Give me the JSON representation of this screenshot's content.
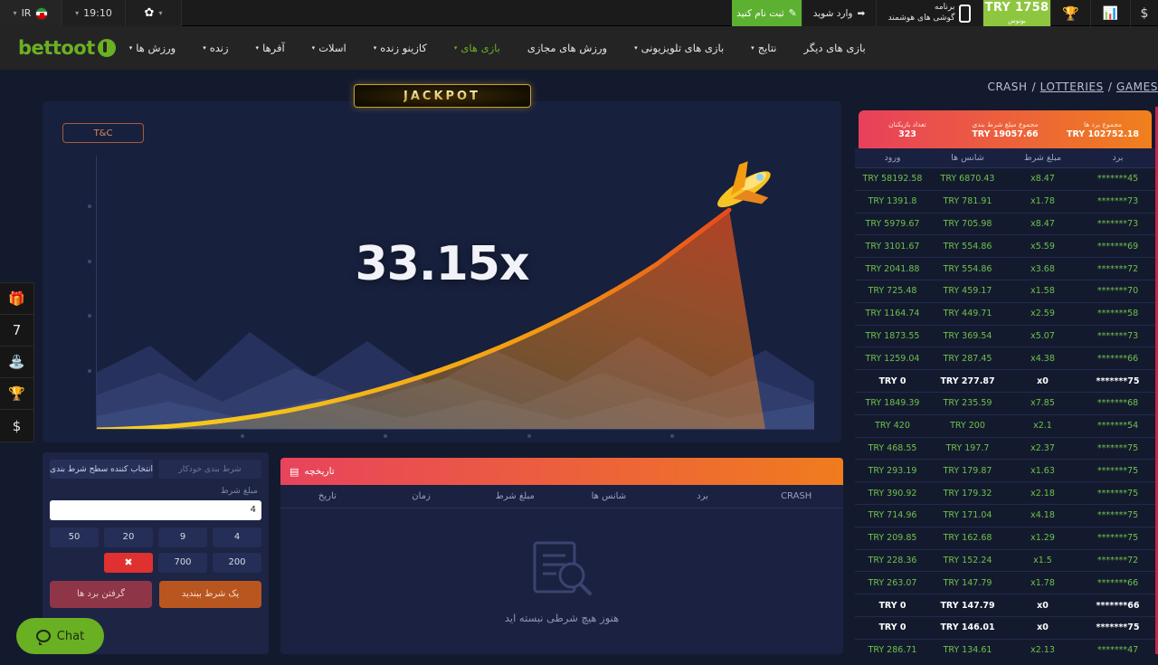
{
  "topbar": {
    "language": "IR",
    "language_icon": "iran-flag-icon",
    "time": "19:10",
    "gear_icon": "gear-icon",
    "signup_label": "ثبت نام کنید",
    "signup_icon": "pencil-icon",
    "login_label": "وارد شوید",
    "login_icon": "login-arrow-icon",
    "apps_line1": "برنامه",
    "apps_line2": "گوشی های هوشمند",
    "apps_icon": "smartphone-icon",
    "bonus_amount": "TRY 1758",
    "bonus_label": "بونوس",
    "trophy_icon": "trophy-icon",
    "stats_icon": "bar-chart-icon",
    "currency_icon": "dollar-icon"
  },
  "nav": {
    "logo_text": "bettoot",
    "items": [
      {
        "label": "ورزش ها",
        "caret": "▾",
        "active": false
      },
      {
        "label": "زنده",
        "caret": "▾",
        "active": false
      },
      {
        "label": "آفرها",
        "caret": "▾",
        "active": false
      },
      {
        "label": "اسلات",
        "caret": "▾",
        "active": false
      },
      {
        "label": "کازینو زنده",
        "caret": "▾",
        "active": false
      },
      {
        "label": "بازی های",
        "caret": "▾",
        "active": true
      },
      {
        "label": "ورزش های مجازی",
        "caret": "",
        "active": false
      },
      {
        "label": "بازی های تلویزیونی",
        "caret": "▾",
        "active": false
      },
      {
        "label": "نتایج",
        "caret": "▾",
        "active": false
      },
      {
        "label": "بازی های دیگر",
        "caret": "",
        "active": false
      }
    ]
  },
  "breadcrumb": {
    "items": [
      "CRASH",
      "LOTTERIES",
      "GAMES"
    ],
    "separator": "/"
  },
  "rail": {
    "items": [
      {
        "name": "gift-icon",
        "glyph": "🎁"
      },
      {
        "name": "seven-icon",
        "glyph": "7"
      },
      {
        "name": "fountain-icon",
        "glyph": "⛲"
      },
      {
        "name": "trophy-icon",
        "glyph": "🏆"
      },
      {
        "name": "dollar-coin-icon",
        "glyph": "$"
      }
    ]
  },
  "game": {
    "jackpot_label": "JACKPOT",
    "tnc_label": "T&C",
    "multiplier": "33.15x"
  },
  "bet_panel": {
    "tab_manual": "انتخاب کننده سطح شرط بندی",
    "tab_auto": "شرط بندی خودکار",
    "amount_label": "مبلغ شرط",
    "amount_value": "4",
    "amount_placeholder": "0",
    "chips": [
      "50",
      "20",
      "9",
      "4"
    ],
    "chips_row2": [
      "",
      "✖",
      "700",
      "200"
    ],
    "clear_icon": "clear-x-icon",
    "take_wins_label": "گرفتن برد ها",
    "place_bet_label": "یک شرط ببندید"
  },
  "history": {
    "title": "تاریخچه",
    "title_icon": "history-icon",
    "columns": [
      "تاریخ",
      "زمان",
      "مبلغ شرط",
      "شانس ها",
      "برد",
      "CRASH"
    ],
    "empty_message": "هنوز هیچ شرطی نبسته اید",
    "empty_icon": "document-search-icon"
  },
  "leaderboard": {
    "stats": [
      {
        "label": "تعداد بازیکنان",
        "value": "323",
        "icon": "user-icon"
      },
      {
        "label": "مجموع مبلغ شرط بندی",
        "value": "TRY 19057.66",
        "icon": "chip-icon"
      },
      {
        "label": "مجموع برد ها",
        "value": "TRY 102752.18",
        "icon": "fire-icon"
      }
    ],
    "columns": [
      "ورود",
      "شانس ها",
      "مبلغ شرط",
      "برد"
    ],
    "rows": [
      {
        "user": "*******45",
        "odds": "x8.47",
        "bet": "TRY 6870.43",
        "win": "TRY 58192.58",
        "zero": false
      },
      {
        "user": "*******73",
        "odds": "x1.78",
        "bet": "TRY 781.91",
        "win": "TRY 1391.8",
        "zero": false
      },
      {
        "user": "*******73",
        "odds": "x8.47",
        "bet": "TRY 705.98",
        "win": "TRY 5979.67",
        "zero": false
      },
      {
        "user": "*******69",
        "odds": "x5.59",
        "bet": "TRY 554.86",
        "win": "TRY 3101.67",
        "zero": false
      },
      {
        "user": "*******72",
        "odds": "x3.68",
        "bet": "TRY 554.86",
        "win": "TRY 2041.88",
        "zero": false
      },
      {
        "user": "*******70",
        "odds": "x1.58",
        "bet": "TRY 459.17",
        "win": "TRY 725.48",
        "zero": false
      },
      {
        "user": "*******58",
        "odds": "x2.59",
        "bet": "TRY 449.71",
        "win": "TRY 1164.74",
        "zero": false
      },
      {
        "user": "*******73",
        "odds": "x5.07",
        "bet": "TRY 369.54",
        "win": "TRY 1873.55",
        "zero": false
      },
      {
        "user": "*******66",
        "odds": "x4.38",
        "bet": "TRY 287.45",
        "win": "TRY 1259.04",
        "zero": false
      },
      {
        "user": "*******75",
        "odds": "x0",
        "bet": "TRY 277.87",
        "win": "TRY 0",
        "zero": true
      },
      {
        "user": "*******68",
        "odds": "x7.85",
        "bet": "TRY 235.59",
        "win": "TRY 1849.39",
        "zero": false
      },
      {
        "user": "*******54",
        "odds": "x2.1",
        "bet": "TRY 200",
        "win": "TRY 420",
        "zero": false
      },
      {
        "user": "*******75",
        "odds": "x2.37",
        "bet": "TRY 197.7",
        "win": "TRY 468.55",
        "zero": false
      },
      {
        "user": "*******75",
        "odds": "x1.63",
        "bet": "TRY 179.87",
        "win": "TRY 293.19",
        "zero": false
      },
      {
        "user": "*******75",
        "odds": "x2.18",
        "bet": "TRY 179.32",
        "win": "TRY 390.92",
        "zero": false
      },
      {
        "user": "*******75",
        "odds": "x4.18",
        "bet": "TRY 171.04",
        "win": "TRY 714.96",
        "zero": false
      },
      {
        "user": "*******75",
        "odds": "x1.29",
        "bet": "TRY 162.68",
        "win": "TRY 209.85",
        "zero": false
      },
      {
        "user": "*******72",
        "odds": "x1.5",
        "bet": "TRY 152.24",
        "win": "TRY 228.36",
        "zero": false
      },
      {
        "user": "*******66",
        "odds": "x1.78",
        "bet": "TRY 147.79",
        "win": "TRY 263.07",
        "zero": false
      },
      {
        "user": "*******66",
        "odds": "x0",
        "bet": "TRY 147.79",
        "win": "TRY 0",
        "zero": true
      },
      {
        "user": "*******75",
        "odds": "x0",
        "bet": "TRY 146.01",
        "win": "TRY 0",
        "zero": true
      },
      {
        "user": "*******47",
        "odds": "x2.13",
        "bet": "TRY 134.61",
        "win": "TRY 286.71",
        "zero": false
      }
    ]
  },
  "chat": {
    "label": "Chat",
    "icon": "chat-bubble-icon"
  },
  "colors": {
    "brand_green": "#6ab023",
    "accent_orange": "#f0801c",
    "accent_red": "#e8405c",
    "panel_bg": "#1d2444",
    "page_bg": "#141a2e",
    "win_green": "#6cc24a"
  }
}
